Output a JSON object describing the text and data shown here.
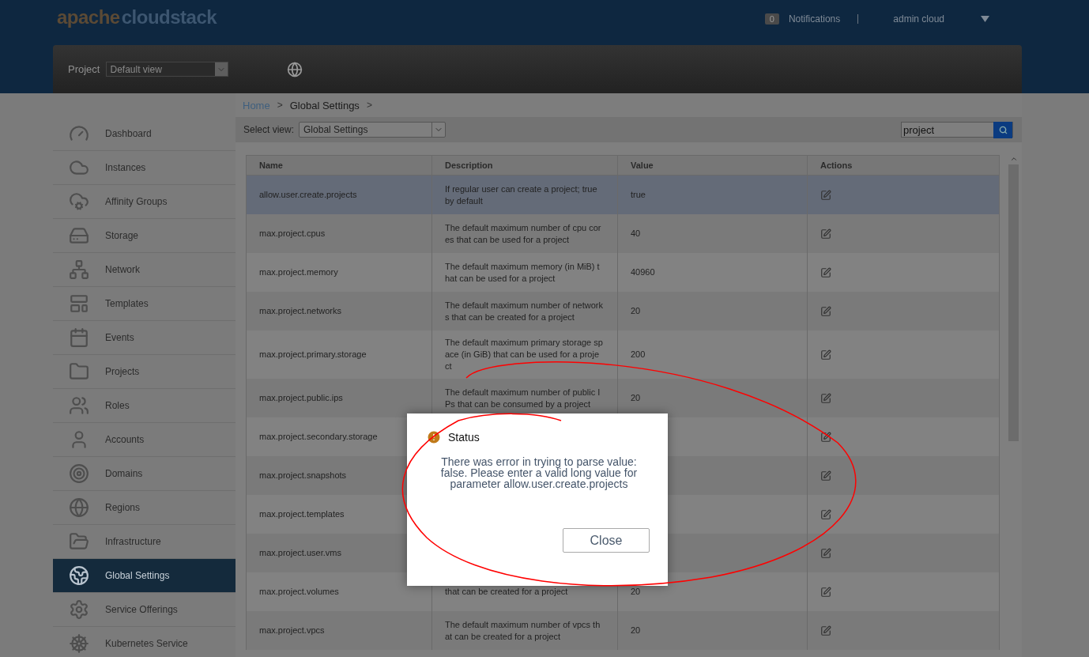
{
  "header": {
    "logo": {
      "part_1": "apache",
      "part_2": "cloudstack"
    },
    "notification_count": "0",
    "notifications_label": "Notifications",
    "user": "admin cloud"
  },
  "toolbar": {
    "project_label": "Project",
    "project_select": "Default view"
  },
  "sidebar": {
    "items": [
      {
        "label": "Dashboard",
        "selected": false
      },
      {
        "label": "Instances",
        "selected": false
      },
      {
        "label": "Affinity Groups",
        "selected": false
      },
      {
        "label": "Storage",
        "selected": false
      },
      {
        "label": "Network",
        "selected": false
      },
      {
        "label": "Templates",
        "selected": false
      },
      {
        "label": "Events",
        "selected": false
      },
      {
        "label": "Projects",
        "selected": false
      },
      {
        "label": "Roles",
        "selected": false
      },
      {
        "label": "Accounts",
        "selected": false
      },
      {
        "label": "Domains",
        "selected": false
      },
      {
        "label": "Regions",
        "selected": false
      },
      {
        "label": "Infrastructure",
        "selected": false
      },
      {
        "label": "Global Settings",
        "selected": true
      },
      {
        "label": "Service Offerings",
        "selected": false
      },
      {
        "label": "Kubernetes Service",
        "selected": false
      }
    ]
  },
  "breadcrumb": [
    {
      "label": "Home",
      "kind": "link",
      "separator": ">"
    },
    {
      "label": "Global Settings",
      "kind": "current",
      "separator": ">"
    }
  ],
  "view_bar": {
    "label": "Select view:",
    "select": "Global Settings",
    "search_value": "project"
  },
  "table": {
    "columns": [
      "Name",
      "Description",
      "Value",
      "Actions"
    ],
    "rows": [
      {
        "name": "allow.user.create.projects",
        "description": "If regular user can create a project; true by default",
        "value": "true",
        "selected": true
      },
      {
        "name": "max.project.cpus",
        "description": "The default maximum number of cpu cores that can be used for a project",
        "value": "40",
        "selected": false
      },
      {
        "name": "max.project.memory",
        "description": "The default maximum memory (in MiB) that can be used for a project",
        "value": "40960",
        "selected": false
      },
      {
        "name": "max.project.networks",
        "description": "The default maximum number of networks that can be created for a project",
        "value": "20",
        "selected": false
      },
      {
        "name": "max.project.primary.storage",
        "description": "The default maximum primary storage space (in GiB) that can be used for a project",
        "value": "200",
        "selected": false
      },
      {
        "name": "max.project.public.ips",
        "description": "The default maximum number of public IPs that can be consumed by a project",
        "value": "20",
        "selected": false
      },
      {
        "name": "max.project.secondary.storage",
        "selected": false
      },
      {
        "name": "max.project.snapshots",
        "selected": false
      },
      {
        "name": "max.project.templates",
        "selected": false
      },
      {
        "name": "max.project.user.vms",
        "selected": false
      },
      {
        "name": "max.project.volumes",
        "description": "that can be created for a project",
        "value": "20",
        "selected": false
      },
      {
        "name": "max.project.vpcs",
        "description": "The default maximum number of vpcs that can be created for a project",
        "value": "20",
        "selected": false
      }
    ]
  },
  "dialog": {
    "title": "Status",
    "message": "There was error in trying to parse value: false. Please enter a valid long value for parameter allow.user.create.projects",
    "button": "Close"
  }
}
